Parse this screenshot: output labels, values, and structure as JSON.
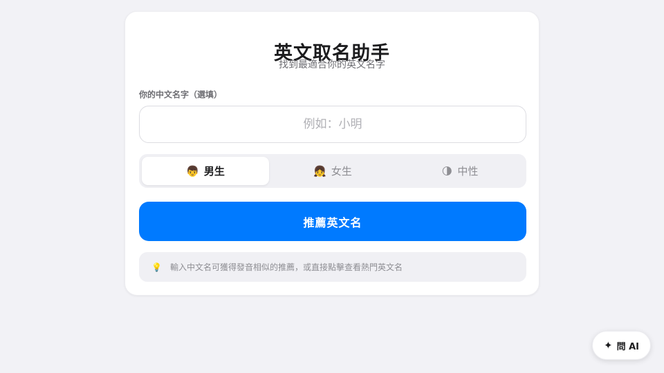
{
  "header": {
    "title": "英文取名助手",
    "subtitle": "找到最適合你的英文名字"
  },
  "form": {
    "field_label": "你的中文名字（選填）",
    "name_value": "",
    "name_placeholder": "例如：小明",
    "gender_options": [
      {
        "emoji": "👦",
        "icon": "boy-emoji-icon",
        "label": "男生",
        "selected": true
      },
      {
        "emoji": "👧",
        "icon": "girl-emoji-icon",
        "label": "女生",
        "selected": false
      },
      {
        "emoji": "🌗",
        "icon": "half-moon-emoji-icon",
        "label": "中性",
        "selected": false
      }
    ],
    "submit_label": "推薦英文名"
  },
  "tip": {
    "icon": "lightbulb-icon",
    "emoji": "💡",
    "text": "輸入中文名可獲得發音相似的推薦，或直接點擊查看熱門英文名"
  },
  "ask_ai": {
    "icon": "sparkle-icon",
    "glyph": "✦",
    "label": "問 AI"
  },
  "colors": {
    "accent": "#007aff",
    "background": "#f2f2f6",
    "card": "#ffffff",
    "muted_text": "#8e8e93"
  }
}
